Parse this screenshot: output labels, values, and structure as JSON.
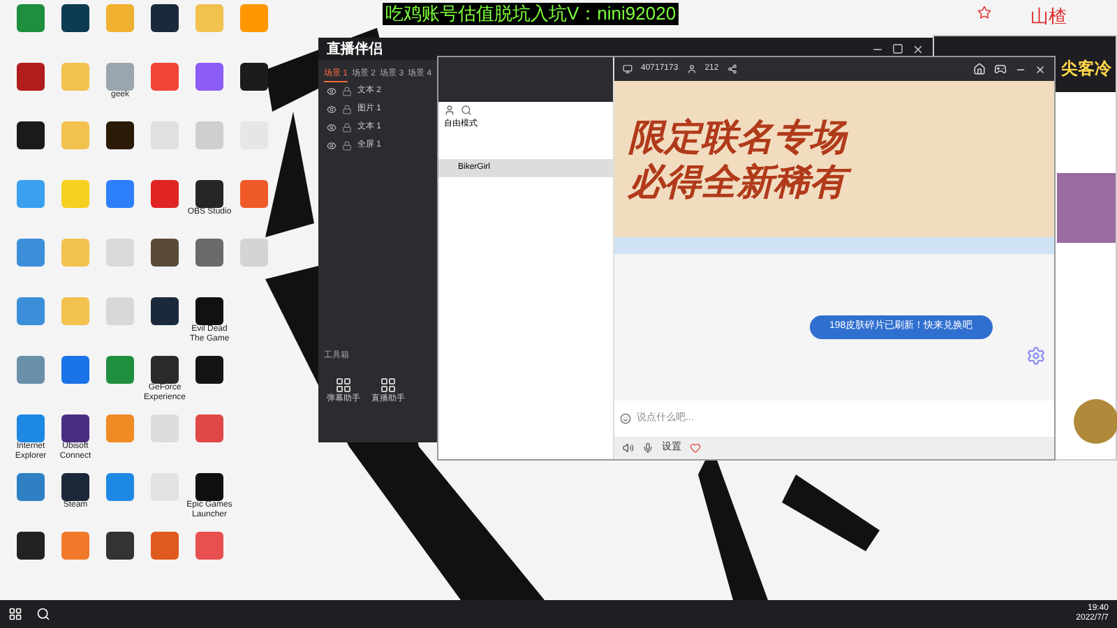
{
  "desktop_icons": [
    {
      "color": "#1f8f3f"
    },
    {
      "color": "#b11c1c"
    },
    {
      "color": "#1a1a1a"
    },
    {
      "color": "#3aa0f0"
    },
    {
      "color": "#3b8fd9"
    },
    {
      "color": "#3b8fd9"
    },
    {
      "color": "#6a8fa8"
    },
    {
      "color": "#1e88e5",
      "label": "Internet Explorer"
    },
    {
      "color": "#2f7fc4"
    },
    {
      "color": "#222222"
    },
    {
      "color": "#0d3b52"
    },
    {
      "color": "#f2c14e"
    },
    {
      "color": "#f2c14e"
    },
    {
      "color": "#f5d020"
    },
    {
      "color": "#f2c14e"
    },
    {
      "color": "#f2c14e"
    },
    {
      "color": "#1a73e8"
    },
    {
      "color": "#4b2e83",
      "label": "Ubisoft Connect"
    },
    {
      "color": "#1b2838",
      "label": "Steam"
    },
    {
      "color": "#f07a2a"
    },
    {
      "color": "#f0b030"
    },
    {
      "color": "#9aa5ad",
      "label": "geek"
    },
    {
      "color": "#2a1a06"
    },
    {
      "color": "#2d7ff9"
    },
    {
      "color": "#d9d9d9"
    },
    {
      "color": "#d8d8d8"
    },
    {
      "color": "#1f8f3f"
    },
    {
      "color": "#f08a24"
    },
    {
      "color": "#1e88e5"
    },
    {
      "color": "#333333"
    },
    {
      "color": "#1a2a3a"
    },
    {
      "color": "#f04438"
    },
    {
      "color": "#e0e0e0"
    },
    {
      "color": "#e02424"
    },
    {
      "color": "#5a4a3a"
    },
    {
      "color": "#1a2a3a"
    },
    {
      "color": "#2a2a2a",
      "label": "GeForce Experience"
    },
    {
      "color": "#dcdcdc"
    },
    {
      "color": "#e2e2e2"
    },
    {
      "color": "#e05a20"
    },
    {
      "color": "#f2c14e"
    },
    {
      "color": "#8b5cf6"
    },
    {
      "color": "#cfcfcf"
    },
    {
      "color": "#262626",
      "label": "OBS Studio"
    },
    {
      "color": "#6a6a6a"
    },
    {
      "color": "#111111",
      "label": "Evil Dead The Game"
    },
    {
      "color": "#141414"
    },
    {
      "color": "#e04848"
    },
    {
      "color": "#101010",
      "label": "Epic Games Launcher"
    },
    {
      "color": "#e85050"
    },
    {
      "color": "#ff9800"
    },
    {
      "color": "#1c1c1c"
    },
    {
      "color": "#e6e6e6"
    },
    {
      "color": "#f05a28"
    },
    {
      "color": "#d4d4d4"
    }
  ],
  "ad_banner": "吃鸡账号估值脱坑入坑V：nini92020",
  "corner_name": "山楂",
  "corner_logo": "尖客冷",
  "streamer_app": {
    "title": "直播伴侣",
    "scenes": [
      {
        "label": "场景 1",
        "selected": true
      },
      {
        "label": "场景 2",
        "selected": false
      },
      {
        "label": "场景 3",
        "selected": false
      },
      {
        "label": "场景 4",
        "selected": false
      }
    ],
    "layers": [
      {
        "label": "文本 2",
        "visible": true
      },
      {
        "label": "图片 1",
        "visible": true
      },
      {
        "label": "文本 1",
        "visible": true
      },
      {
        "label": "全屏 1",
        "visible": true
      }
    ],
    "toolbox_title": "工具箱",
    "tools": [
      {
        "label": "弹幕助手"
      },
      {
        "label": "直播助手"
      }
    ]
  },
  "chat_window": {
    "viewers": "40717173",
    "fans": "212",
    "mode": "自由模式",
    "members": [
      {
        "name": "BikerGirl",
        "selected": true
      }
    ],
    "banner_lines": [
      "限定联名专场",
      "必得全新稀有"
    ],
    "bubble": "198皮肤碎片已刷新！快来兑换吧",
    "input_placeholder": "说点什么吧...",
    "settings": "设置"
  },
  "taskbar": {
    "time": "19:40",
    "date": "2022/7/7"
  }
}
